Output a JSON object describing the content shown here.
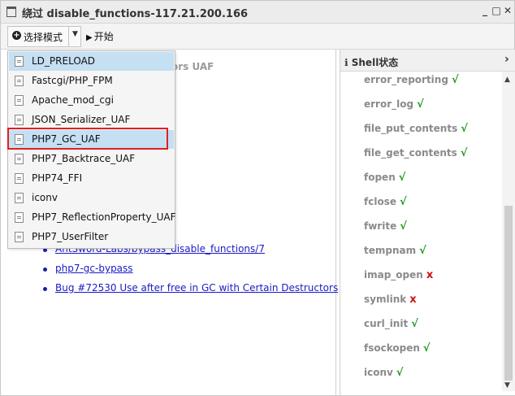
{
  "window": {
    "title": "绕过 disable_functions-117.21.200.166"
  },
  "toolbar": {
    "mode_label": "选择模式",
    "start_label": "开始"
  },
  "left": {
    "faded_text": "ors UAF",
    "links": [
      "AntSword-Labs/bypass_disable_functions/7",
      "php7-gc-bypass",
      "Bug #72530 Use after free in GC with Certain Destructors"
    ]
  },
  "dropdown": {
    "items": [
      "LD_PRELOAD",
      "Fastcgi/PHP_FPM",
      "Apache_mod_cgi",
      "JSON_Serializer_UAF",
      "PHP7_GC_UAF",
      "PHP7_Backtrace_UAF",
      "PHP74_FFI",
      "iconv",
      "PHP7_ReflectionProperty_UAF",
      "PHP7_UserFilter"
    ],
    "highlighted": [
      "LD_PRELOAD",
      "PHP7_GC_UAF"
    ],
    "boxed": "PHP7_GC_UAF"
  },
  "shell_status": {
    "title": "Shell状态",
    "functions": [
      {
        "name": "error_reporting",
        "mark": "√",
        "ok": true
      },
      {
        "name": "error_log",
        "mark": "√",
        "ok": true
      },
      {
        "name": "file_put_contents",
        "mark": "√",
        "ok": true
      },
      {
        "name": "file_get_contents",
        "mark": "√",
        "ok": true
      },
      {
        "name": "fopen",
        "mark": "√",
        "ok": true
      },
      {
        "name": "fclose",
        "mark": "√",
        "ok": true
      },
      {
        "name": "fwrite",
        "mark": "√",
        "ok": true
      },
      {
        "name": "tempnam",
        "mark": "√",
        "ok": true
      },
      {
        "name": "imap_open",
        "mark": "x",
        "ok": false
      },
      {
        "name": "symlink",
        "mark": "x",
        "ok": false
      },
      {
        "name": "curl_init",
        "mark": "√",
        "ok": true
      },
      {
        "name": "fsockopen",
        "mark": "√",
        "ok": true
      },
      {
        "name": "iconv",
        "mark": "√",
        "ok": true
      }
    ]
  },
  "colors": {
    "ok": "#1a9a1a",
    "fail": "#d01010",
    "selection": "#c5dff3",
    "highlight_border": "#e02020",
    "link": "#1a1ac8"
  }
}
